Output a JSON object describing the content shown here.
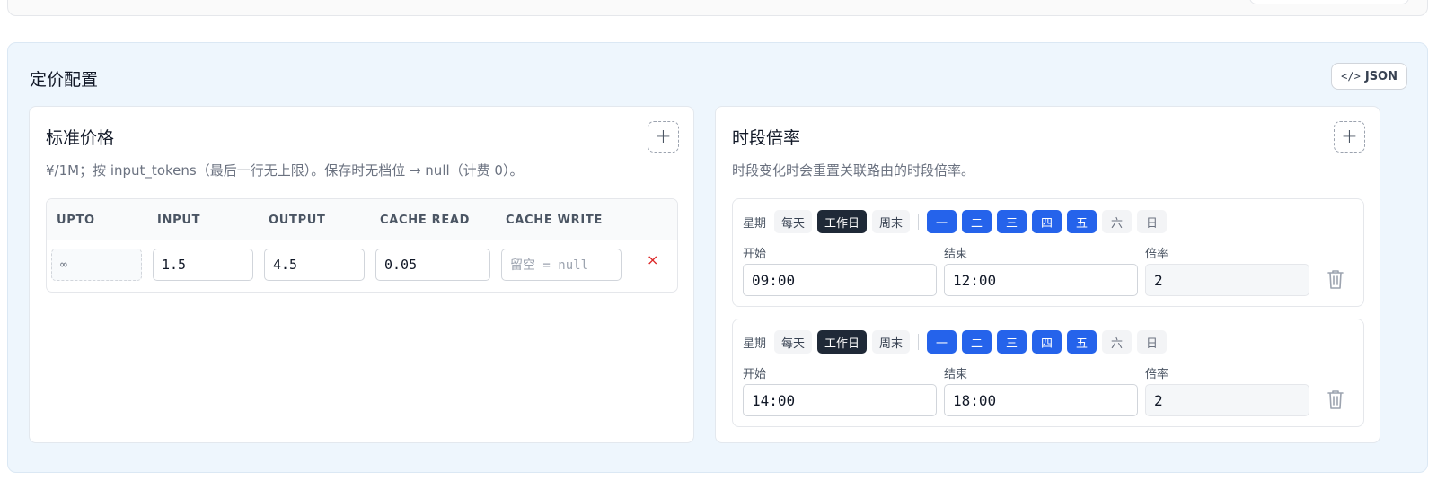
{
  "panel": {
    "title": "定价配置",
    "json_button": "JSON"
  },
  "standard": {
    "title": "标准价格",
    "description": "¥/1M；按 input_tokens（最后一行无上限）。保存时无档位 → null（计费 0）。",
    "columns": [
      "UPTO",
      "INPUT",
      "OUTPUT",
      "CACHE READ",
      "CACHE WRITE"
    ],
    "rows": [
      {
        "upto": "∞",
        "input": "1.5",
        "output": "4.5",
        "cache_read": "0.05",
        "cache_write_placeholder": "留空 = null",
        "delete": "×"
      }
    ]
  },
  "timeslot": {
    "title": "时段倍率",
    "description": "时段变化时会重置关联路由的时段倍率。",
    "weekday_label": "星期",
    "presets": [
      "每天",
      "工作日",
      "周末"
    ],
    "active_preset": "工作日",
    "days": [
      "一",
      "二",
      "三",
      "四",
      "五",
      "六",
      "日"
    ],
    "labels": {
      "start": "开始",
      "end": "结束",
      "rate": "倍率"
    },
    "slots": [
      {
        "start": "09:00",
        "end": "12:00",
        "rate": "2",
        "days_on": [
          true,
          true,
          true,
          true,
          true,
          false,
          false
        ]
      },
      {
        "start": "14:00",
        "end": "18:00",
        "rate": "2",
        "days_on": [
          true,
          true,
          true,
          true,
          true,
          false,
          false
        ]
      }
    ]
  },
  "colors": {
    "accent": "#2563eb",
    "dark": "#1f2937",
    "danger": "#dc2626",
    "panel_bg": "#eef6fd"
  },
  "icons": {
    "add": "plus-icon",
    "json": "code-icon",
    "delete_row": "close-icon",
    "delete_slot": "trash-icon"
  }
}
